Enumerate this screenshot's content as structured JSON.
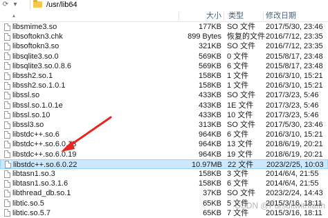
{
  "address": {
    "path": "/usr/lib64",
    "folder_icon": "folder-icon"
  },
  "toolbar": {
    "refresh_icon": "⟳",
    "dropdown_icon": "▾"
  },
  "columns": {
    "size": "大小",
    "type": "类型",
    "modified": "修改日期",
    "sort_icon": "▴"
  },
  "files": [
    {
      "name": "libsmime3.so",
      "size": "177KB",
      "type": "SO 文件",
      "date": "2017/5/30, 23:46"
    },
    {
      "name": "libsoftokn3.chk",
      "size": "899 Bytes",
      "type": "恢复的文件",
      "date": "2016/7/12, 23:35"
    },
    {
      "name": "libsoftokn3.so",
      "size": "321KB",
      "type": "SO 文件",
      "date": "2016/7/12, 23:35"
    },
    {
      "name": "libsqlite3.so.0",
      "size": "569KB",
      "type": "0 文件",
      "date": "2015/8/17, 23:48"
    },
    {
      "name": "libsqlite3.so.0.8.6",
      "size": "569KB",
      "type": "6 文件",
      "date": "2015/8/17, 23:48"
    },
    {
      "name": "libssh2.so.1",
      "size": "158KB",
      "type": "1 文件",
      "date": "2016/3/10, 15:21"
    },
    {
      "name": "libssh2.so.1.0.1",
      "size": "158KB",
      "type": "1 文件",
      "date": "2016/3/10, 15:21"
    },
    {
      "name": "libssl.so",
      "size": "433KB",
      "type": "SO 文件",
      "date": "2017/3/23, 5:46"
    },
    {
      "name": "libssl.so.1.0.1e",
      "size": "433KB",
      "type": "1E 文件",
      "date": "2017/3/23, 5:46"
    },
    {
      "name": "libssl.so.10",
      "size": "433KB",
      "type": "10 文件",
      "date": "2017/3/23, 5:46"
    },
    {
      "name": "libssl3.so",
      "size": "313KB",
      "type": "SO 文件",
      "date": "2017/5/30, 23:46"
    },
    {
      "name": "libstdc++.so.6",
      "size": "964KB",
      "type": "6 文件",
      "date": "2016/3/10, 15:21"
    },
    {
      "name": "libstdc++.so.6.0.13",
      "size": "964KB",
      "type": "13 文件",
      "date": "2018/6/19, 20:21"
    },
    {
      "name": "libstdc++.so.6.0.19",
      "size": "964KB",
      "type": "19 文件",
      "date": "2018/6/19, 20:21"
    },
    {
      "name": "libstdc++.so.6.0.22",
      "size": "10.97MB",
      "type": "22 文件",
      "date": "2023/2/25, 10:03",
      "state": "selected"
    },
    {
      "name": "libtasn1.so.3",
      "size": "158KB",
      "type": "3 文件",
      "date": "2014/6/4, 21:55"
    },
    {
      "name": "libtasn1.so.3.1.6",
      "size": "158KB",
      "type": "6 文件",
      "date": "2014/6/4, 21:55"
    },
    {
      "name": "libthread_db.so.1",
      "size": "37KB",
      "type": "SO 文件",
      "date": "2023/2/24, 14:43"
    },
    {
      "name": "libtic.so.5",
      "size": "65KB",
      "type": "5 文件",
      "date": "2015/3/16, 18:11"
    },
    {
      "name": "libtic.so.5.7",
      "size": "65KB",
      "type": "7 文件",
      "date": "2015/3/16, 18:11"
    }
  ],
  "watermark": "CSDN @Pursuitwithfaith",
  "colors": {
    "selected_bg": "#cce8ff",
    "selected_border": "#99d1ff",
    "hover_bg": "#e5f3ff",
    "arrow": "#e8251e",
    "header_text": "#4c607a"
  }
}
